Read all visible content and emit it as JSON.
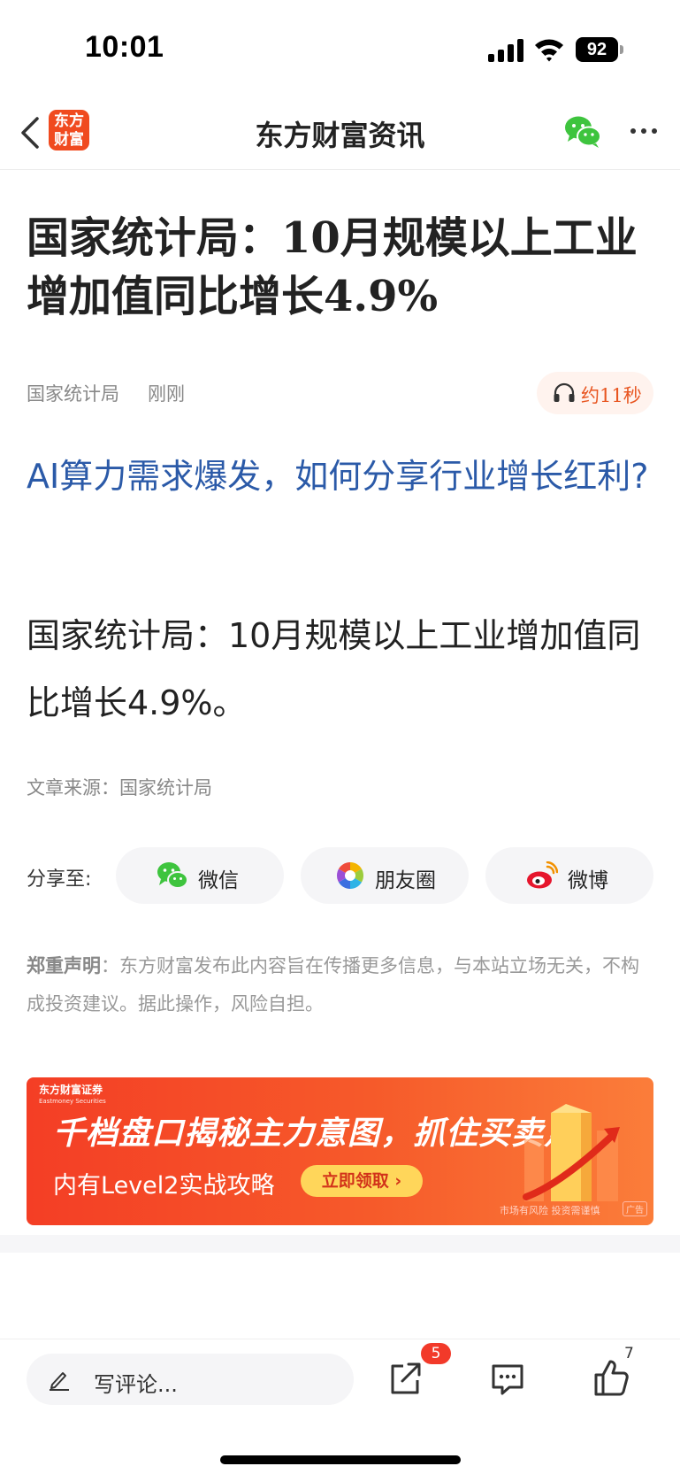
{
  "status_bar": {
    "time": "10:01",
    "battery": "92"
  },
  "nav": {
    "logo_line1": "东方",
    "logo_line2": "财富",
    "title": "东方财富资讯"
  },
  "article": {
    "headline": "国家统计局：10月规模以上工业增加值同比增长4.9%",
    "source": "国家统计局",
    "time": "刚刚",
    "audio_label": "约11秒",
    "promo_link": "AI算力需求爆发，如何分享行业增长红利?",
    "body": "国家统计局：10月规模以上工业增加值同比增长4.9%。",
    "article_source": "文章来源：国家统计局"
  },
  "share": {
    "label": "分享至:",
    "options": [
      {
        "label": "微信",
        "icon": "wechat-icon"
      },
      {
        "label": "朋友圈",
        "icon": "moments-icon"
      },
      {
        "label": "微博",
        "icon": "weibo-icon"
      }
    ]
  },
  "disclaimer": {
    "title": "郑重声明",
    "text": "：东方财富发布此内容旨在传播更多信息，与本站立场无关，不构成投资建议。据此操作，风险自担。"
  },
  "ad": {
    "brand": "东方财富证券",
    "brand_sub": "Eastmoney Securities",
    "headline": "千档盘口揭秘主力意图，抓住买卖点",
    "sub": "内有Level2实战攻略",
    "cta": "立即领取 ›",
    "risk": "市场有风险 投资需谨慎",
    "tag": "广告"
  },
  "bottom_bar": {
    "comment_placeholder": "写评论...",
    "share_badge": "5",
    "like_count": "7"
  },
  "colors": {
    "accent_orange": "#f04a1f",
    "link_blue": "#2b5aa8",
    "badge_red": "#f23a2a",
    "wechat_green": "#3ec43e"
  }
}
